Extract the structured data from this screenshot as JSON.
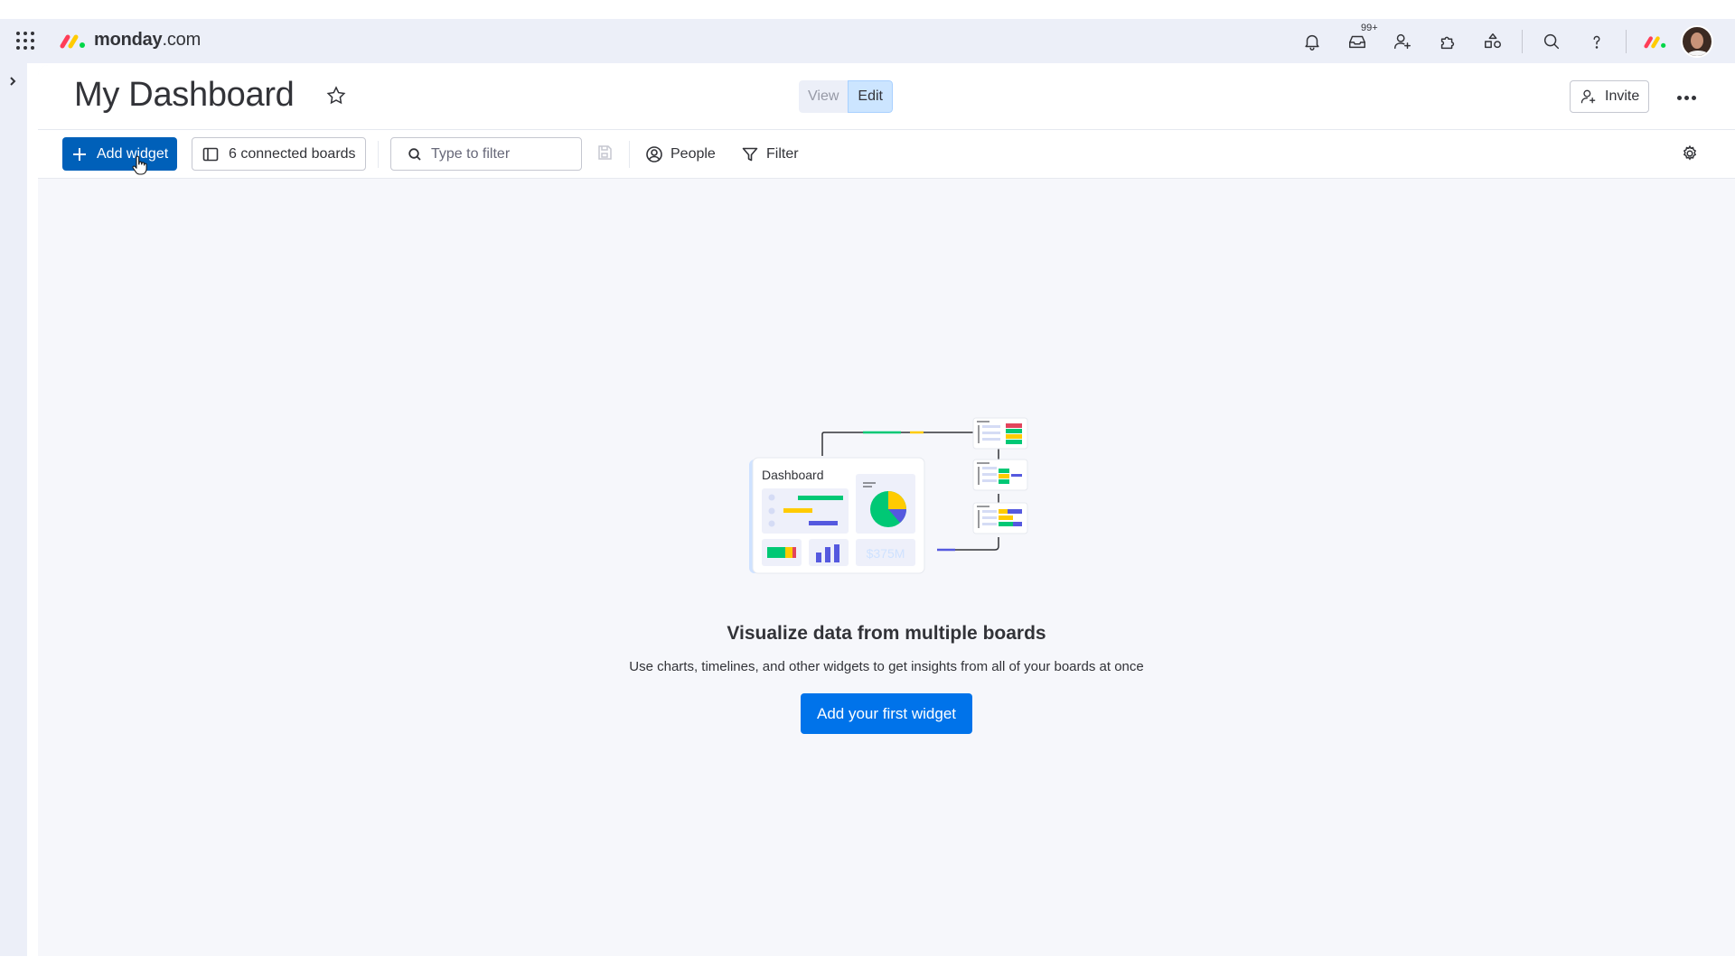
{
  "app": {
    "brand_bold": "monday",
    "brand_light": ".com"
  },
  "topbar": {
    "inbox_badge": "99+"
  },
  "dashboard": {
    "title": "My Dashboard",
    "view_label": "View",
    "edit_label": "Edit",
    "invite_label": "Invite"
  },
  "toolbar": {
    "add_widget_label": "Add widget",
    "connected_boards_label": "6 connected boards",
    "filter_placeholder": "Type to filter",
    "people_label": "People",
    "filter_label": "Filter"
  },
  "illustration": {
    "card_title": "Dashboard",
    "amount": "$375M"
  },
  "empty_state": {
    "title": "Visualize data from multiple boards",
    "subtitle": "Use charts, timelines, and other widgets to get insights from all of your boards at once",
    "cta_label": "Add your first widget"
  },
  "colors": {
    "primary": "#0073ea",
    "primary_dark": "#0060b9",
    "green": "#00c875",
    "yellow": "#ffcb00",
    "purple": "#5559df",
    "red": "#e2445c",
    "brand_red": "#ff3d57",
    "brand_yellow": "#ffcb00",
    "brand_green": "#00d647"
  }
}
